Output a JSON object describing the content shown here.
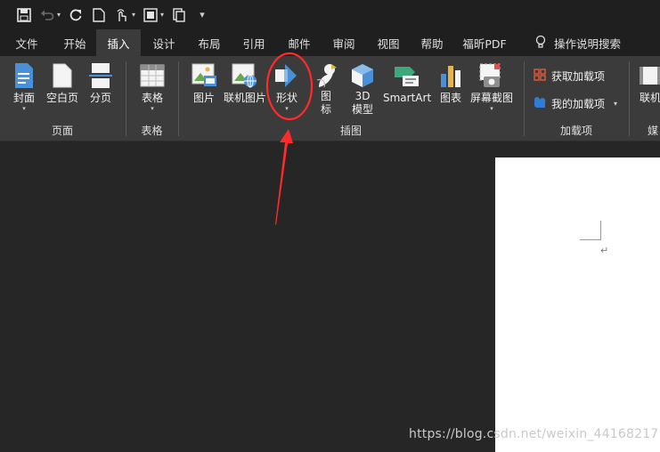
{
  "quick_access": {
    "icons": [
      "save-icon",
      "undo-icon",
      "redo-icon",
      "new-document-icon",
      "touch-mode-icon",
      "print-preview-icon",
      "copy-icon",
      "customize-icon"
    ]
  },
  "tabs": [
    {
      "label": "文件"
    },
    {
      "label": "开始"
    },
    {
      "label": "插入",
      "active": true
    },
    {
      "label": "设计"
    },
    {
      "label": "布局"
    },
    {
      "label": "引用"
    },
    {
      "label": "邮件"
    },
    {
      "label": "审阅"
    },
    {
      "label": "视图"
    },
    {
      "label": "帮助"
    },
    {
      "label": "福昕PDF"
    }
  ],
  "tell_me": "操作说明搜索",
  "ribbon": {
    "groups": {
      "pages": "页面",
      "tables": "表格",
      "illustrations": "插图",
      "addins": "加载项",
      "media": "媒"
    },
    "buttons": {
      "cover": "封面",
      "blank_page": "空白页",
      "page_break": "分页",
      "table": "表格",
      "picture": "图片",
      "online_picture": "联机图片",
      "shapes": "形状",
      "icons_1": "图",
      "icons_2": "标",
      "model_1": "3D",
      "model_2": "模型",
      "smartart": "SmartArt",
      "chart": "图表",
      "screenshot": "屏幕截图",
      "get_addins": "获取加载项",
      "my_addins": "我的加载项",
      "online_video": "联机"
    }
  },
  "document": {
    "paragraph_mark": "↵"
  },
  "watermark": "https://blog.csdn.net/weixin_44168217",
  "colors": {
    "accent_red": "#ff2a2a",
    "tab_active_bg": "#3b3b3b",
    "ribbon_bg": "#3b3b3b",
    "workspace_bg": "#262626",
    "icon_blue": "#4a90d9"
  }
}
